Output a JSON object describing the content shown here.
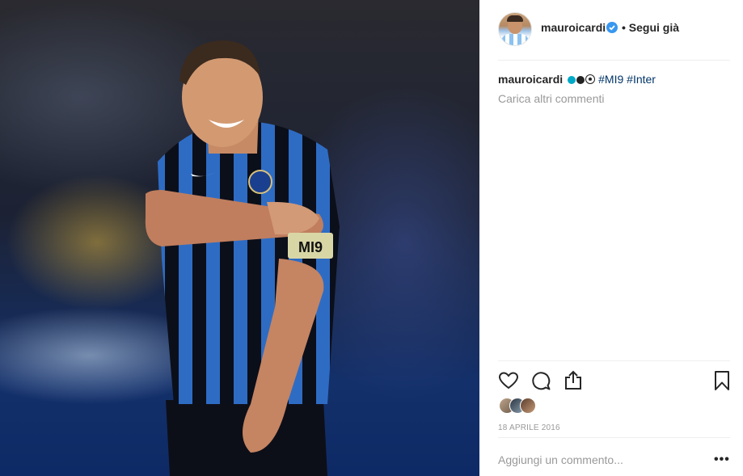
{
  "post": {
    "image_alt": "Player smiling in striped jersey",
    "armband_text": "MI9"
  },
  "header": {
    "username": "mauroicardi",
    "verified_icon": "verified-badge-icon",
    "follow_label": "• Segui già"
  },
  "caption": {
    "username": "mauroicardi",
    "emojis": [
      "#00a8c8",
      "#222222",
      "soccer-ball"
    ],
    "tags": [
      "#MI9",
      "#Inter"
    ]
  },
  "comments": {
    "load_more": "Carica altri commenti"
  },
  "actions": {
    "icons": [
      "heart-icon",
      "comment-icon",
      "share-icon",
      "bookmark-icon"
    ]
  },
  "date": "18 APRILE 2016",
  "comment_box": {
    "placeholder": "Aggiungi un commento...",
    "more_label": "•••"
  },
  "colors": {
    "link": "#003569",
    "muted": "#999999",
    "verified": "#3897f0"
  }
}
